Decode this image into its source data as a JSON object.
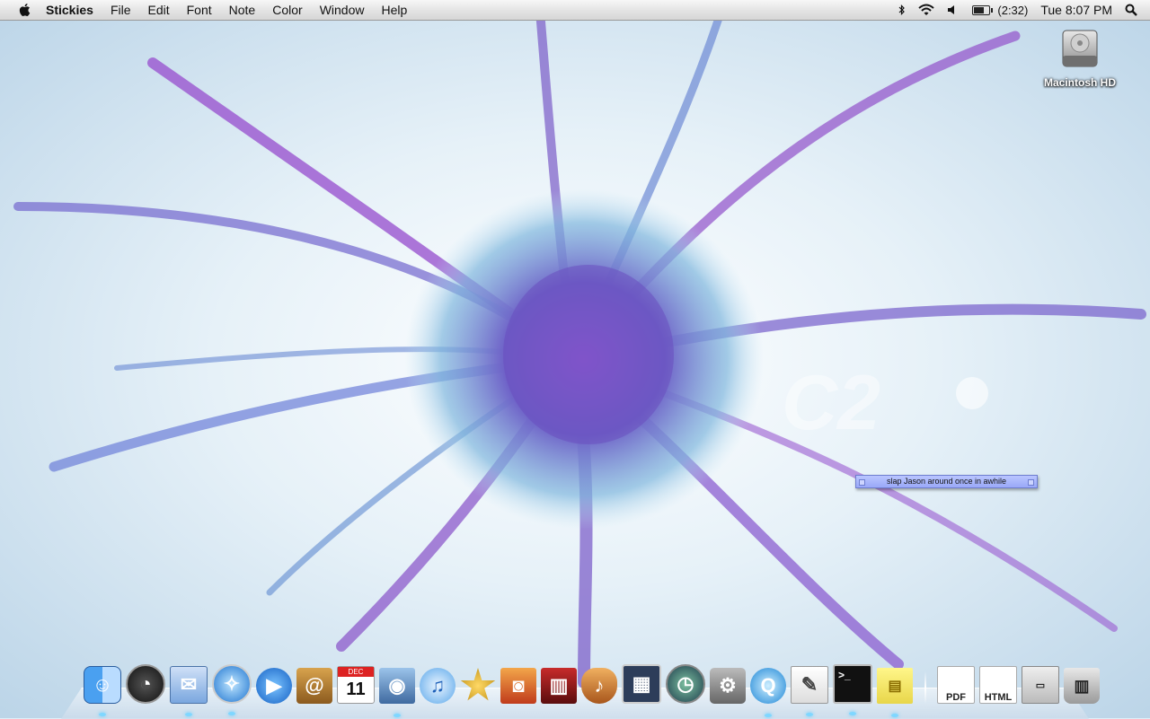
{
  "menubar": {
    "apple_icon": "apple-logo-icon",
    "app_name": "Stickies",
    "menus": [
      "File",
      "Edit",
      "Font",
      "Note",
      "Color",
      "Window",
      "Help"
    ],
    "status": {
      "bluetooth_icon": "bluetooth-icon",
      "wifi_icon": "wifi-icon",
      "volume_icon": "volume-icon",
      "battery_icon": "battery-icon",
      "battery_time": "(2:32)",
      "clock": "Tue 8:07 PM",
      "spotlight_icon": "spotlight-icon"
    }
  },
  "desktop": {
    "hd_label": "Macintosh HD"
  },
  "sticky": {
    "text": "slap Jason around once in awhile"
  },
  "dock": {
    "apps": [
      {
        "name": "finder",
        "running": true
      },
      {
        "name": "dashboard",
        "running": false
      },
      {
        "name": "mail",
        "running": true
      },
      {
        "name": "safari",
        "running": true
      },
      {
        "name": "ichat",
        "running": false
      },
      {
        "name": "address-book",
        "running": false
      },
      {
        "name": "ical",
        "running": false
      },
      {
        "name": "iphoto",
        "running": true
      },
      {
        "name": "itunes",
        "running": false
      },
      {
        "name": "imovie",
        "running": false
      },
      {
        "name": "photo-booth",
        "running": false
      },
      {
        "name": "front-row",
        "running": false
      },
      {
        "name": "garageband",
        "running": false
      },
      {
        "name": "spaces",
        "running": false
      },
      {
        "name": "time-machine",
        "running": false
      },
      {
        "name": "system-preferences",
        "running": false
      },
      {
        "name": "quicktime",
        "running": true
      },
      {
        "name": "textedit",
        "running": true
      },
      {
        "name": "terminal",
        "running": true
      },
      {
        "name": "stickies",
        "running": true
      }
    ],
    "docs": [
      {
        "name": "pdf-document",
        "label": "PDF"
      },
      {
        "name": "html-document",
        "label": "HTML"
      },
      {
        "name": "screenshot-document"
      },
      {
        "name": "trash"
      }
    ],
    "calendar_month": "DEC",
    "calendar_day": "11",
    "accent": "#7fd7ff"
  }
}
